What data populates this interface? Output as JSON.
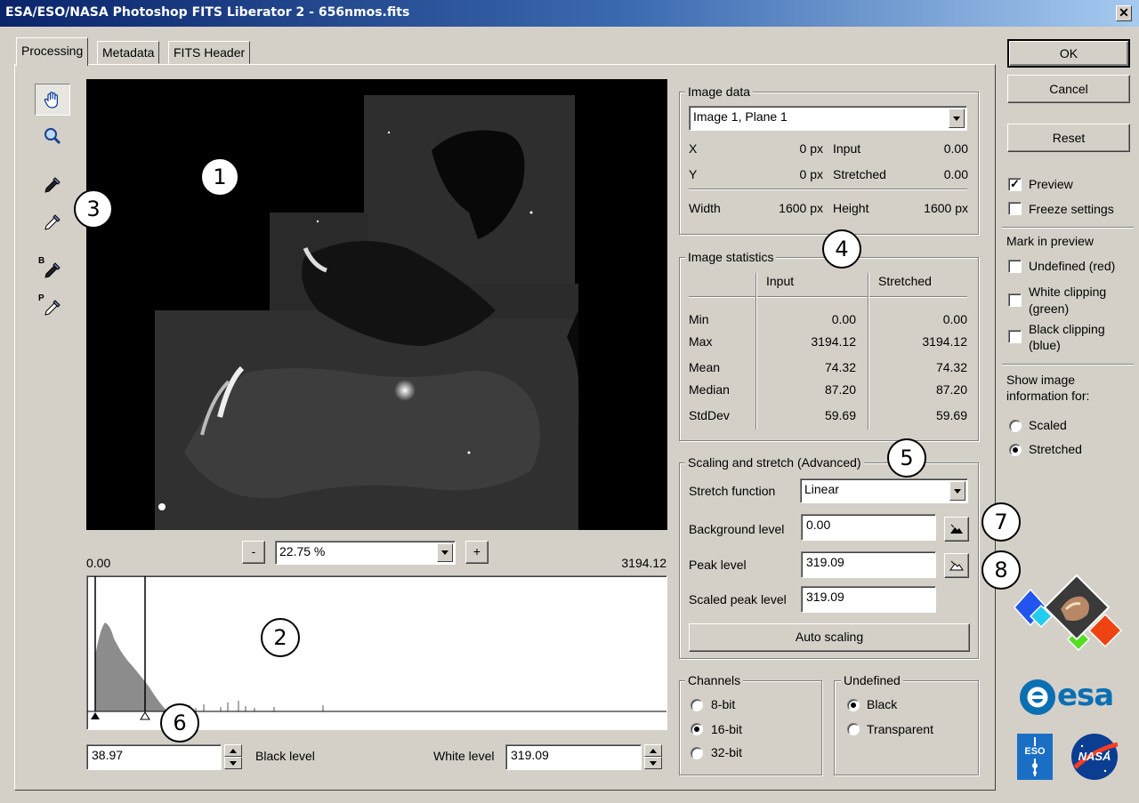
{
  "window": {
    "title": "ESA/ESO/NASA Photoshop FITS Liberator 2 - 656nmos.fits",
    "close_glyph": "✕"
  },
  "tabs": [
    {
      "label": "Processing",
      "active": true
    },
    {
      "label": "Metadata"
    },
    {
      "label": "FITS Header"
    }
  ],
  "tools": {
    "flip_b": "B",
    "flip_p": "P"
  },
  "callouts": [
    "1",
    "2",
    "3",
    "4",
    "5",
    "6",
    "7",
    "8"
  ],
  "zoom": {
    "minus": "-",
    "plus": "+",
    "value": "22.75 %"
  },
  "histogram": {
    "min_label": "0.00",
    "max_label": "3194.12",
    "black_field": "38.97",
    "black_label": "Black level",
    "white_label": "White level",
    "white_field": "319.09"
  },
  "image_data": {
    "legend": "Image data",
    "plane": "Image 1, Plane 1",
    "x_label": "X",
    "x_value": "0 px",
    "input_label": "Input",
    "input_value": "0.00",
    "y_label": "Y",
    "y_value": "0 px",
    "stretched_label": "Stretched",
    "stretched_value": "0.00",
    "width_label": "Width",
    "width_value": "1600 px",
    "height_label": "Height",
    "height_value": "1600 px"
  },
  "stats": {
    "legend": "Image statistics",
    "col_input": "Input",
    "col_stretched": "Stretched",
    "rows": [
      {
        "label": "Min",
        "input": "0.00",
        "stretched": "0.00"
      },
      {
        "label": "Max",
        "input": "3194.12",
        "stretched": "3194.12"
      },
      {
        "label": "Mean",
        "input": "74.32",
        "stretched": "74.32"
      },
      {
        "label": "Median",
        "input": "87.20",
        "stretched": "87.20"
      },
      {
        "label": "StdDev",
        "input": "59.69",
        "stretched": "59.69"
      }
    ]
  },
  "scaling": {
    "legend": "Scaling and stretch (Advanced)",
    "stretch_label": "Stretch function",
    "stretch_value": "Linear",
    "background_label": "Background level",
    "background_value": "0.00",
    "peak_label": "Peak level",
    "peak_value": "319.09",
    "scaled_peak_label": "Scaled peak level",
    "scaled_peak_value": "319.09",
    "auto_button": "Auto scaling"
  },
  "channels": {
    "legend": "Channels",
    "options": [
      "8-bit",
      "16-bit",
      "32-bit"
    ],
    "selected": "16-bit"
  },
  "undefined": {
    "legend": "Undefined",
    "options": [
      "Black",
      "Transparent"
    ],
    "selected": "Black"
  },
  "buttons": {
    "ok": "OK",
    "cancel": "Cancel",
    "reset": "Reset"
  },
  "options": {
    "preview": "Preview",
    "preview_checked": true,
    "freeze": "Freeze settings",
    "freeze_checked": false,
    "mark_heading": "Mark in preview",
    "undefined_red": "Undefined (red)",
    "white_clip_1": "White clipping",
    "white_clip_2": "(green)",
    "black_clip_1": "Black clipping",
    "black_clip_2": "(blue)",
    "show_info_1": "Show image",
    "show_info_2": "information for:",
    "scaled": "Scaled",
    "stretched": "Stretched",
    "info_selected": "Stretched"
  },
  "logos": {
    "esa": "esa",
    "eso": "ESO",
    "nasa": "NASA"
  }
}
